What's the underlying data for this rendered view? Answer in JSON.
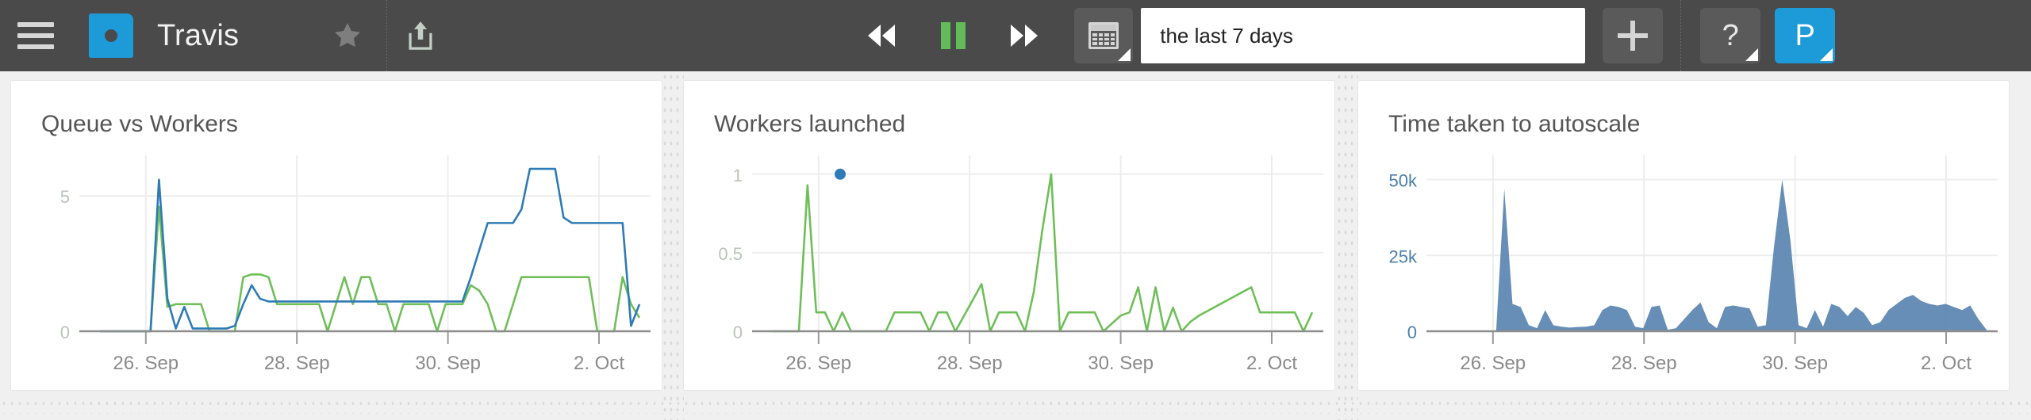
{
  "topbar": {
    "menu_icon": "hamburger-icon",
    "logo_icon": "app-logo-icon",
    "app_title": "Travis",
    "star_icon": "star-icon",
    "share_icon": "share-upload-icon",
    "rewind_icon": "rewind-icon",
    "pause_icon": "pause-icon",
    "forward_icon": "fast-forward-icon",
    "calendar_icon": "calendar-icon",
    "time_range_value": "the last 7 days",
    "time_range_placeholder": "the last 7 days",
    "add_label": "+",
    "help_label": "?",
    "avatar_label": "P",
    "accent_blue": "#1d9bd8",
    "play_green": "#63bb5a",
    "bar_background": "#4a4a4a"
  },
  "chart_data": [
    {
      "type": "line",
      "title": "Queue vs Workers",
      "xlabel": "",
      "ylabel": "",
      "ylim": [
        0,
        6.5
      ],
      "yticks": [
        0,
        5
      ],
      "ytick_labels": [
        "0",
        "5"
      ],
      "grid": true,
      "legend": "none",
      "xtick_labels": [
        "26. Sep",
        "28. Sep",
        "30. Sep",
        "2. Oct"
      ],
      "xtick_positions": [
        0.085,
        0.365,
        0.645,
        0.925
      ],
      "colors": {
        "queue": "#6fbf59",
        "workers": "#2e7bb5"
      },
      "series": [
        {
          "name": "queue",
          "color": "#6fbf59",
          "values": [
            0,
            0,
            0,
            0,
            0,
            0,
            0,
            4.6,
            0.9,
            1.0,
            1.0,
            1.0,
            1.0,
            0,
            0,
            0,
            0,
            2.0,
            2.1,
            2.1,
            2.0,
            1.0,
            1.0,
            1.0,
            1.0,
            1.0,
            1.0,
            0,
            1.0,
            2.0,
            1.0,
            2.0,
            2.0,
            1.0,
            1.0,
            0,
            1.0,
            1.0,
            1.0,
            1.0,
            0,
            1.0,
            1.0,
            1.0,
            1.7,
            1.5,
            1.0,
            0,
            0,
            1.0,
            2.0,
            2.0,
            2.0,
            2.0,
            2.0,
            2.0,
            2.0,
            2.0,
            2.0,
            0,
            0,
            0,
            2.0,
            1.0,
            0.5
          ]
        },
        {
          "name": "workers",
          "color": "#2e7bb5",
          "values": [
            0,
            0,
            0,
            0,
            0,
            0,
            0,
            5.6,
            1.2,
            0.1,
            0.9,
            0.1,
            0.1,
            0.1,
            0.1,
            0.1,
            0.2,
            1.0,
            1.7,
            1.2,
            1.1,
            1.1,
            1.1,
            1.1,
            1.1,
            1.1,
            1.1,
            1.1,
            1.1,
            1.1,
            1.1,
            1.1,
            1.1,
            1.1,
            1.1,
            1.1,
            1.1,
            1.1,
            1.1,
            1.1,
            1.1,
            1.1,
            1.1,
            1.1,
            2.0,
            3.0,
            4.0,
            4.0,
            4.0,
            4.0,
            4.5,
            6.0,
            6.0,
            6.0,
            6.0,
            4.2,
            4.0,
            4.0,
            4.0,
            4.0,
            4.0,
            4.0,
            4.0,
            0.2,
            1.0
          ]
        }
      ]
    },
    {
      "type": "line",
      "title": "Workers launched",
      "xlabel": "",
      "ylabel": "",
      "ylim": [
        0,
        1.12
      ],
      "yticks": [
        0,
        0.5,
        1
      ],
      "ytick_labels": [
        "0",
        "0.5",
        "1"
      ],
      "grid": true,
      "legend": "none",
      "xtick_labels": [
        "26. Sep",
        "28. Sep",
        "30. Sep",
        "2. Oct"
      ],
      "xtick_positions": [
        0.085,
        0.365,
        0.645,
        0.925
      ],
      "markers": [
        {
          "x": 0.125,
          "y": 1.0,
          "color": "#2e7bb5",
          "name": "highlight-point"
        }
      ],
      "series": [
        {
          "name": "workers launched",
          "color": "#6fbf59",
          "values": [
            0,
            0,
            0,
            0,
            0.93,
            0.12,
            0.12,
            0,
            0.12,
            0,
            0,
            0,
            0,
            0,
            0.12,
            0.12,
            0.12,
            0.12,
            0,
            0.12,
            0.12,
            0,
            0.1,
            0.2,
            0.3,
            0,
            0.12,
            0.12,
            0.12,
            0,
            0.25,
            0.65,
            1.0,
            0,
            0.12,
            0.12,
            0.12,
            0.12,
            0,
            0.05,
            0.1,
            0.12,
            0.28,
            0,
            0.28,
            0,
            0.15,
            0,
            0.06,
            0.1,
            0.13,
            0.16,
            0.19,
            0.22,
            0.25,
            0.28,
            0.12,
            0.12,
            0.12,
            0.12,
            0.12,
            0,
            0.12
          ]
        }
      ]
    },
    {
      "type": "area",
      "title": "Time taken to autoscale",
      "xlabel": "",
      "ylabel": "",
      "ylim": [
        0,
        58000
      ],
      "yticks": [
        0,
        25000,
        50000
      ],
      "ytick_labels": [
        "0",
        "25k",
        "50k"
      ],
      "ytick_color": "#4a7fae",
      "grid": true,
      "legend": "none",
      "xtick_labels": [
        "26. Sep",
        "28. Sep",
        "30. Sep",
        "2. Oct"
      ],
      "xtick_positions": [
        0.085,
        0.365,
        0.645,
        0.925
      ],
      "series": [
        {
          "name": "time to autoscale",
          "color": "#5a84b0",
          "values": [
            0,
            0,
            0,
            0,
            0,
            0,
            0,
            47000,
            9000,
            8000,
            2000,
            1000,
            7000,
            2000,
            1500,
            1200,
            1400,
            1500,
            2000,
            7000,
            8500,
            8000,
            7000,
            1500,
            1000,
            8000,
            8500,
            500,
            1000,
            4000,
            7000,
            9500,
            3000,
            1000,
            8000,
            8500,
            8000,
            7500,
            1500,
            2000,
            28000,
            50000,
            30000,
            2000,
            1000,
            7000,
            1500,
            9000,
            8000,
            5000,
            8000,
            6000,
            2000,
            3000,
            7000,
            9000,
            11000,
            12000,
            10000,
            9000,
            8500,
            9000,
            8000,
            7000,
            8500,
            4000,
            500
          ]
        }
      ]
    }
  ]
}
